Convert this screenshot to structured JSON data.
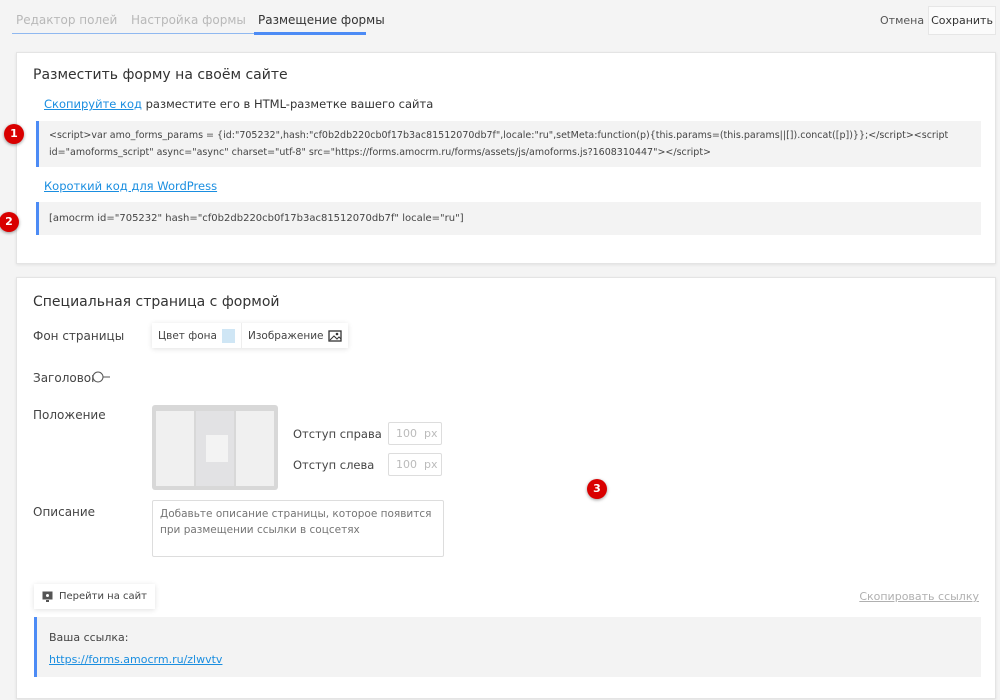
{
  "tabs": [
    {
      "label": "Редактор полей"
    },
    {
      "label": "Настройка формы"
    },
    {
      "label": "Размещение формы"
    }
  ],
  "header": {
    "cancel": "Отмена",
    "save": "Сохранить"
  },
  "embed": {
    "title": "Разместить форму на своём сайте",
    "copy_link": "Скопируйте код",
    "copy_text": "разместите его в HTML-разметке вашего сайта",
    "code": "<script>var amo_forms_params = {id:\"705232\",hash:\"cf0b2db220cb0f17b3ac81512070db7f\",locale:\"ru\",setMeta:function(p){this.params=(this.params||[]).concat([p])}};</script><script id=\"amoforms_script\" async=\"async\" charset=\"utf-8\" src=\"https://forms.amocrm.ru/forms/assets/js/amoforms.js?1608310447\"></script>",
    "wp_link": "Короткий код для WordPress",
    "wp_code": "[amocrm id=\"705232\" hash=\"cf0b2db220cb0f17b3ac81512070db7f\" locale=\"ru\"]"
  },
  "page": {
    "title": "Специальная страница с формой",
    "bg_label": "Фон страницы",
    "bg_color": "Цвет фона",
    "bg_color_value": "#cfe6f5",
    "bg_image": "Изображение",
    "header_label": "Заголовок",
    "position_label": "Положение",
    "right_label": "Отступ справа",
    "right_value": "100",
    "left_label": "Отступ слева",
    "left_value": "100",
    "unit": "px",
    "desc_label": "Описание",
    "desc_placeholder": "Добавьте описание страницы, которое появится при размещении ссылки в соцсетях",
    "goto_site": "Перейти на сайт",
    "copy_link": "Скопировать ссылку",
    "your_link_label": "Ваша ссылка:",
    "your_link": "https://forms.amocrm.ru/zlwvtv"
  },
  "markers": [
    "1",
    "2",
    "3"
  ],
  "accent": "#4c8bf5"
}
